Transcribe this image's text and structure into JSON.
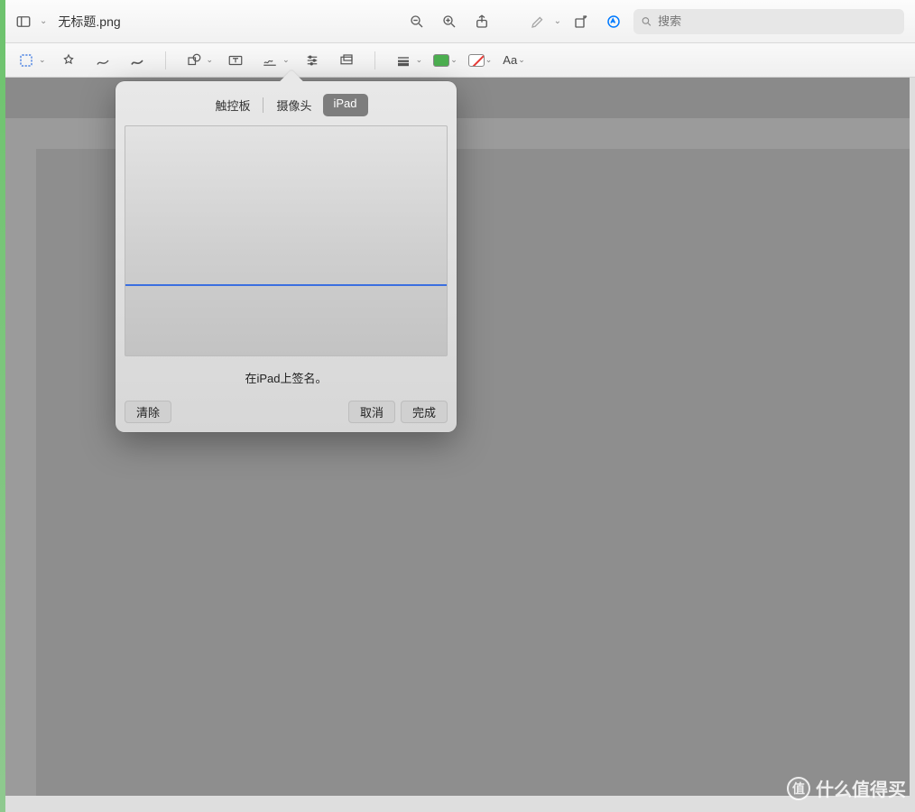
{
  "window": {
    "title": "无标题.png"
  },
  "search": {
    "placeholder": "搜索"
  },
  "markup": {
    "text_style": "Aa"
  },
  "popover": {
    "tabs": {
      "trackpad": "触控板",
      "camera": "摄像头",
      "ipad": "iPad"
    },
    "hint": "在iPad上签名。",
    "buttons": {
      "clear": "清除",
      "cancel": "取消",
      "done": "完成"
    }
  },
  "watermark": {
    "badge": "值",
    "text": "什么值得买"
  }
}
